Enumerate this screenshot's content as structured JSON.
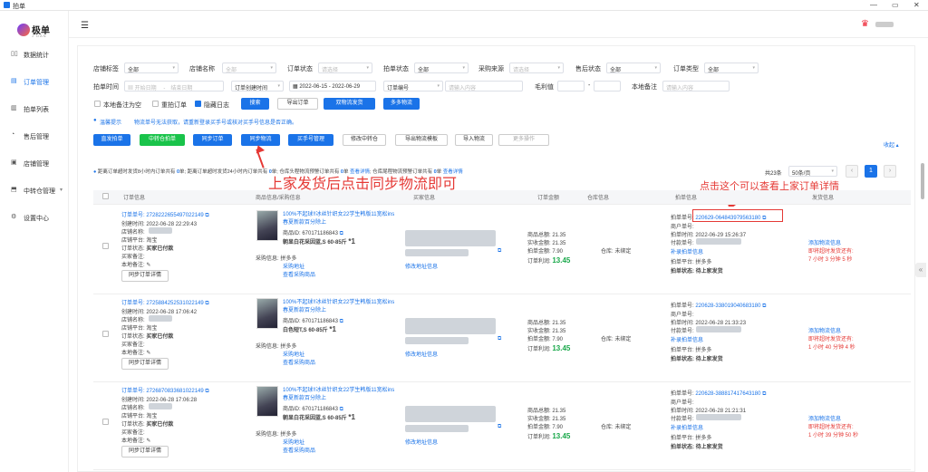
{
  "app": {
    "title": "拍单"
  },
  "window_controls": {
    "min": "—",
    "max": "▭",
    "close": "✕"
  },
  "logo": {
    "text": "极单",
    "sub": "J DAN"
  },
  "sidebar": {
    "items": [
      {
        "label": "数据统计",
        "icon": "▯▯"
      },
      {
        "label": "订单管理",
        "icon": "▤"
      },
      {
        "label": "拍单列表",
        "icon": "▥"
      },
      {
        "label": "售后管理",
        "icon": "◔"
      },
      {
        "label": "店铺管理",
        "icon": "▣"
      },
      {
        "label": "中转仓管理",
        "icon": "⬒",
        "caret": "▾"
      },
      {
        "label": "设置中心",
        "icon": "⚙"
      }
    ]
  },
  "header": {
    "menu_icon": "☰",
    "crown_icon": "♛"
  },
  "filters": {
    "row1": [
      {
        "label": "店铺标签",
        "value": "全部"
      },
      {
        "label": "店铺名称",
        "value": "全部"
      },
      {
        "label": "订单状态",
        "placeholder": "请选择"
      },
      {
        "label": "拍单状态",
        "value": "全部"
      },
      {
        "label": "采购来源",
        "placeholder": "请选择"
      },
      {
        "label": "售后状态",
        "value": "全部"
      },
      {
        "label": "订单类型",
        "value": "全部"
      }
    ],
    "row2": {
      "label": "拍单时间",
      "start_ph": "开始日期",
      "sep": "-",
      "end_ph": "结束日期",
      "order_time_sel": "订单创建时间",
      "date_range": "2022-06-15  -  2022-06-29",
      "order_no_sel": "订单编号",
      "order_no_ph": "请输入内容",
      "gross_label": "毛利值",
      "gross_sep": "-",
      "note_label": "本地备注",
      "note_ph": "请输入内容"
    },
    "row3": {
      "note_empty": "本地备注为空",
      "repeat": "重拍订单",
      "hide_log": "隐藏日志",
      "search": "搜索",
      "export": "导出订单",
      "dual_ship": "双物流发货",
      "multi_ship": "多多物流"
    },
    "tip_label": "温馨提示",
    "tip_text": "物流单号无法获取，请重新登录买手号或核对买手号信息是否正确。"
  },
  "actions": [
    "直发拍单",
    "中转仓拍单",
    "同步订单",
    "同步物流",
    "买手号管理",
    "修改中转仓",
    "导出物流模板",
    "导入物流",
    "更多操作"
  ],
  "collapse": "收起 ▴",
  "status_line": {
    "p1": "距离订单超时发货8小时内订单共有",
    "n1": "0",
    "p2": "单; 距离订单超时发货24小时内订单共有",
    "n2": "0",
    "p3": "单; 仓库头程物流预警订单共有",
    "n3": "0",
    "p4": "单",
    "link1": "查看详情",
    "p5": "; 仓库尾程物流预警订单共有",
    "n4": "0",
    "p6": "单",
    "link2": "查看详情"
  },
  "pagination": {
    "total": "共23条",
    "page_size": "50条/页",
    "prev": "‹",
    "current": "1",
    "next": "›"
  },
  "annotations": {
    "main": "上家发货后点击同步物流即可",
    "detail": "点击这个可以查看上家订单详情"
  },
  "table": {
    "headers": [
      "订单信息",
      "商品信息/采购信息",
      "买家信息",
      "订单金额",
      "仓库信息",
      "拍单信息",
      "发货信息"
    ],
    "rows": [
      {
        "order_no": "订单单号: 2728222655497022149",
        "created": "创建时间: 2022-06-28 22:29:43",
        "shop": "店铺名称:",
        "platform": "店铺平台: 淘宝",
        "status_label": "订单状态:",
        "status": "买家已付款",
        "buyer_note": "买家备注:",
        "local_note": "本地备注:",
        "sync_btn": "同步订单详情",
        "product": "100%不起球!!冰丝针织女22学生韩版11宽松ins春夏新款百分除上",
        "product_id": "商品ID: 670171186843",
        "sku": "朝显白花采因蓝,S 60-85斤",
        "qty": "*1",
        "purchase_label": "采购信息: 拼多多",
        "purchase_addr": "采购地址",
        "purchase_view": "查看采购商品",
        "addr_link": "修改地址信息",
        "amt_total": "商品总额: 21.35",
        "amt_paid": "实收金额: 21.35",
        "amt_pd": "拍单金额: 7.90",
        "amt_profit_label": "订单利润:",
        "amt_profit": "13.45",
        "wh": "仓库: 未绑定",
        "pd_no_label": "拍单单号:",
        "pd_no": "220629-064843979563180",
        "merchant": "商户单号:",
        "pd_time": "拍单时间: 2022-06-29 15:26:37",
        "pay_no": "付款单号:",
        "pd_fill": "补录拍单信息",
        "pd_platform": "拍单平台: 拼多多",
        "pd_status": "拍单状态: 待上家发货",
        "ship_add": "添加物流信息",
        "ship_warn": "即将超时发货还有:",
        "ship_time": "7 小时 3 分钟 5 秒"
      },
      {
        "order_no": "订单单号: 2725884252531022149",
        "created": "创建时间: 2022-06-28 17:06:42",
        "shop": "店铺名称:",
        "platform": "店铺平台: 淘宝",
        "status_label": "订单状态:",
        "status": "买家已付款",
        "buyer_note": "买家备注:",
        "local_note": "本地备注:",
        "sync_btn": "同步订单详情",
        "product": "100%不起球!!冰丝针织女22学生韩版11宽松ins春夏新款百分除上",
        "product_id": "商品ID: 670171186843",
        "sku": "白色短T,S 60-85斤",
        "qty": "*1",
        "purchase_label": "采购信息: 拼多多",
        "purchase_addr": "采购地址",
        "purchase_view": "查看采购商品",
        "addr_link": "修改地址信息",
        "amt_total": "商品总额: 21.35",
        "amt_paid": "实收金额: 21.35",
        "amt_pd": "拍单金额: 7.90",
        "amt_profit_label": "订单利润:",
        "amt_profit": "13.45",
        "wh": "仓库: 未绑定",
        "pd_no_label": "拍单单号:",
        "pd_no": "220628-338019040683180",
        "merchant": "商户单号:",
        "pd_time": "拍单时间: 2022-06-28 21:33:23",
        "pay_no": "付款单号:",
        "pd_fill": "补录拍单信息",
        "pd_platform": "拍单平台: 拼多多",
        "pd_status": "拍单状态: 待上家发货",
        "ship_add": "添加物流信息",
        "ship_warn": "即将超时发货还有:",
        "ship_time": "1 小时 40 分钟 4 秒"
      },
      {
        "order_no": "订单单号: 2726870833681022149",
        "created": "创建时间: 2022-06-28 17:06:28",
        "shop": "店铺名称:",
        "platform": "店铺平台: 淘宝",
        "status_label": "订单状态:",
        "status": "买家已付款",
        "buyer_note": "买家备注:",
        "local_note": "本地备注:",
        "sync_btn": "同步订单详情",
        "product": "100%不起球!!冰丝针织女22学生韩版11宽松ins春夏新款百分除上",
        "product_id": "商品ID: 670171186843",
        "sku": "朝显白花采因蓝,S 60-85斤",
        "qty": "*1",
        "purchase_label": "采购信息: 拼多多",
        "purchase_addr": "采购地址",
        "purchase_view": "查看采购商品",
        "addr_link": "修改地址信息",
        "amt_total": "商品总额: 21.35",
        "amt_paid": "实收金额: 21.35",
        "amt_pd": "拍单金额: 7.90",
        "amt_profit_label": "订单利润:",
        "amt_profit": "13.45",
        "wh": "仓库: 未绑定",
        "pd_no_label": "拍单单号:",
        "pd_no": "220628-388817417643180",
        "merchant": "商户单号:",
        "pd_time": "拍单时间: 2022-06-28 21:21:31",
        "pay_no": "付款单号:",
        "pd_fill": "补录拍单信息",
        "pd_platform": "拍单平台: 拼多多",
        "pd_status": "拍单状态: 待上家发货",
        "ship_add": "添加物流信息",
        "ship_warn": "即将超时发货还有:",
        "ship_time": "1 小时 39 分钟 50 秒"
      }
    ]
  }
}
